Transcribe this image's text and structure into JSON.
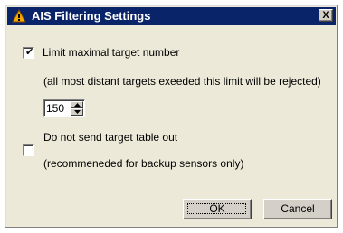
{
  "window": {
    "title": "AIS Filtering Settings",
    "close_label": "X"
  },
  "limit": {
    "checkbox_checked": true,
    "label": "Limit maximal target number",
    "note": "(all most distant targets exeeded this limit will be rejected)",
    "value": "150"
  },
  "table_out": {
    "checkbox_checked": false,
    "label": "Do not send target table out",
    "note": "(recommeneded for backup sensors only)"
  },
  "buttons": {
    "ok": "OK",
    "cancel": "Cancel"
  },
  "colors": {
    "title_bar": "#0a246a",
    "dialog_bg": "#ece9d8",
    "icon_accent": "#f6a800"
  },
  "icons": {
    "title": "warning-triangle-icon",
    "close": "close-icon"
  }
}
